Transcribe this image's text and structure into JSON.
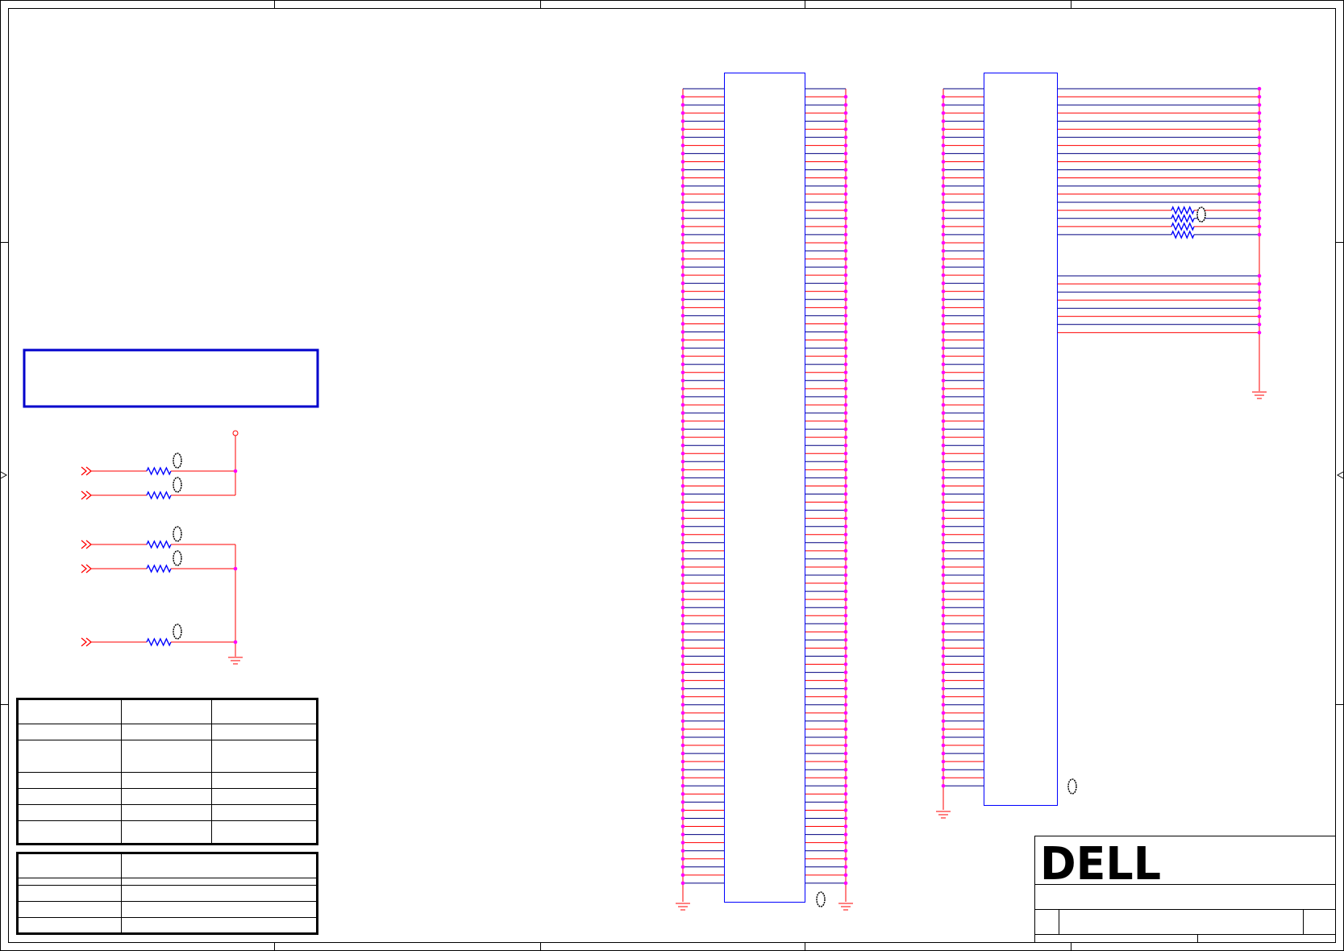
{
  "sheet": {
    "title": "",
    "logo_text": "DELL",
    "colors": {
      "frame": "#000000",
      "wire": "#ff0000",
      "wire_dark": "#000080",
      "junction": "#ff00ff",
      "component": "#0000ff",
      "note_box": "#0000cc"
    }
  },
  "left_circuit": {
    "resistor_count": 5,
    "resistor_marker": "CP",
    "pullup_symbol": "open-circle-pin",
    "ground_symbol": "ground-icon"
  },
  "connector_j1": {
    "pin_rows": 100,
    "marker": "CP"
  },
  "connector_j2": {
    "pin_rows": 87,
    "marker": "CP",
    "series_resistors": 4
  },
  "bom_table_1": {
    "rows": 7,
    "cols": 3
  },
  "bom_table_2": {
    "rows": 4,
    "cols": 2
  }
}
